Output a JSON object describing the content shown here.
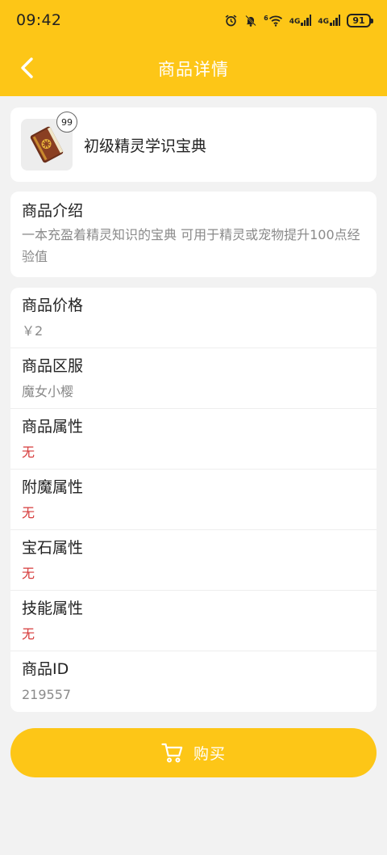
{
  "status_bar": {
    "time": "09:42",
    "net_label": "4G",
    "sim_label": "6",
    "battery": "91"
  },
  "header": {
    "title": "商品详情"
  },
  "product": {
    "name": "初级精灵学识宝典",
    "quantity": "99"
  },
  "intro": {
    "title": "商品介绍",
    "description": "一本充盈着精灵知识的宝典 可用于精灵或宠物提升100点经验值"
  },
  "details": [
    {
      "label": "商品价格",
      "value": "￥2",
      "highlight": false
    },
    {
      "label": "商品区服",
      "value": "魔女小樱",
      "highlight": false
    },
    {
      "label": "商品属性",
      "value": "无",
      "highlight": true
    },
    {
      "label": "附魔属性",
      "value": "无",
      "highlight": true
    },
    {
      "label": "宝石属性",
      "value": "无",
      "highlight": true
    },
    {
      "label": "技能属性",
      "value": "无",
      "highlight": true
    },
    {
      "label": "商品ID",
      "value": "219557",
      "highlight": false
    }
  ],
  "buy_button": {
    "label": "购买"
  },
  "colors": {
    "brand_yellow": "#fdc617",
    "alert_red": "#d63a3a"
  }
}
